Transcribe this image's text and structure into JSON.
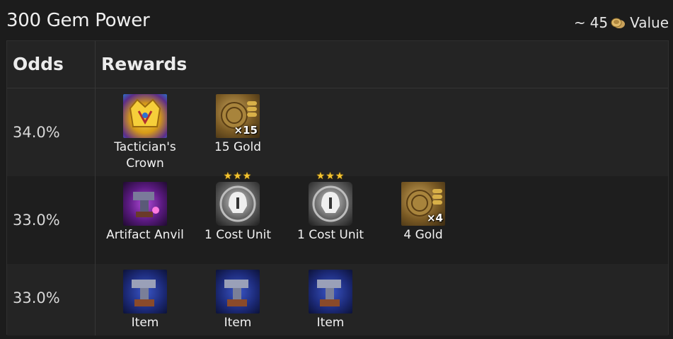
{
  "header": {
    "title": "300 Gem Power",
    "value_prefix": "~",
    "value_amount": "45",
    "value_icon": "coin-stack-icon",
    "value_suffix": "Value"
  },
  "table": {
    "col_odds": "Odds",
    "col_rewards": "Rewards",
    "rows": [
      {
        "odds": "34.0%",
        "rewards": [
          {
            "icon": "tacticians-crown-icon",
            "label": "Tactician's Crown",
            "qty": ""
          },
          {
            "icon": "gold-coin-icon",
            "label": "15 Gold",
            "qty": "×15"
          }
        ]
      },
      {
        "odds": "33.0%",
        "rewards": [
          {
            "icon": "artifact-anvil-icon",
            "label": "Artifact Anvil",
            "qty": ""
          },
          {
            "icon": "unit-helmet-icon",
            "label": "1 Cost Unit",
            "stars": "★★★"
          },
          {
            "icon": "unit-helmet-icon",
            "label": "1 Cost Unit",
            "stars": "★★★"
          },
          {
            "icon": "gold-coin-icon",
            "label": "4 Gold",
            "qty": "×4"
          }
        ]
      },
      {
        "odds": "33.0%",
        "rewards": [
          {
            "icon": "item-anvil-icon",
            "label": "Item"
          },
          {
            "icon": "item-anvil-icon",
            "label": "Item"
          },
          {
            "icon": "item-anvil-icon",
            "label": "Item"
          }
        ]
      }
    ]
  }
}
